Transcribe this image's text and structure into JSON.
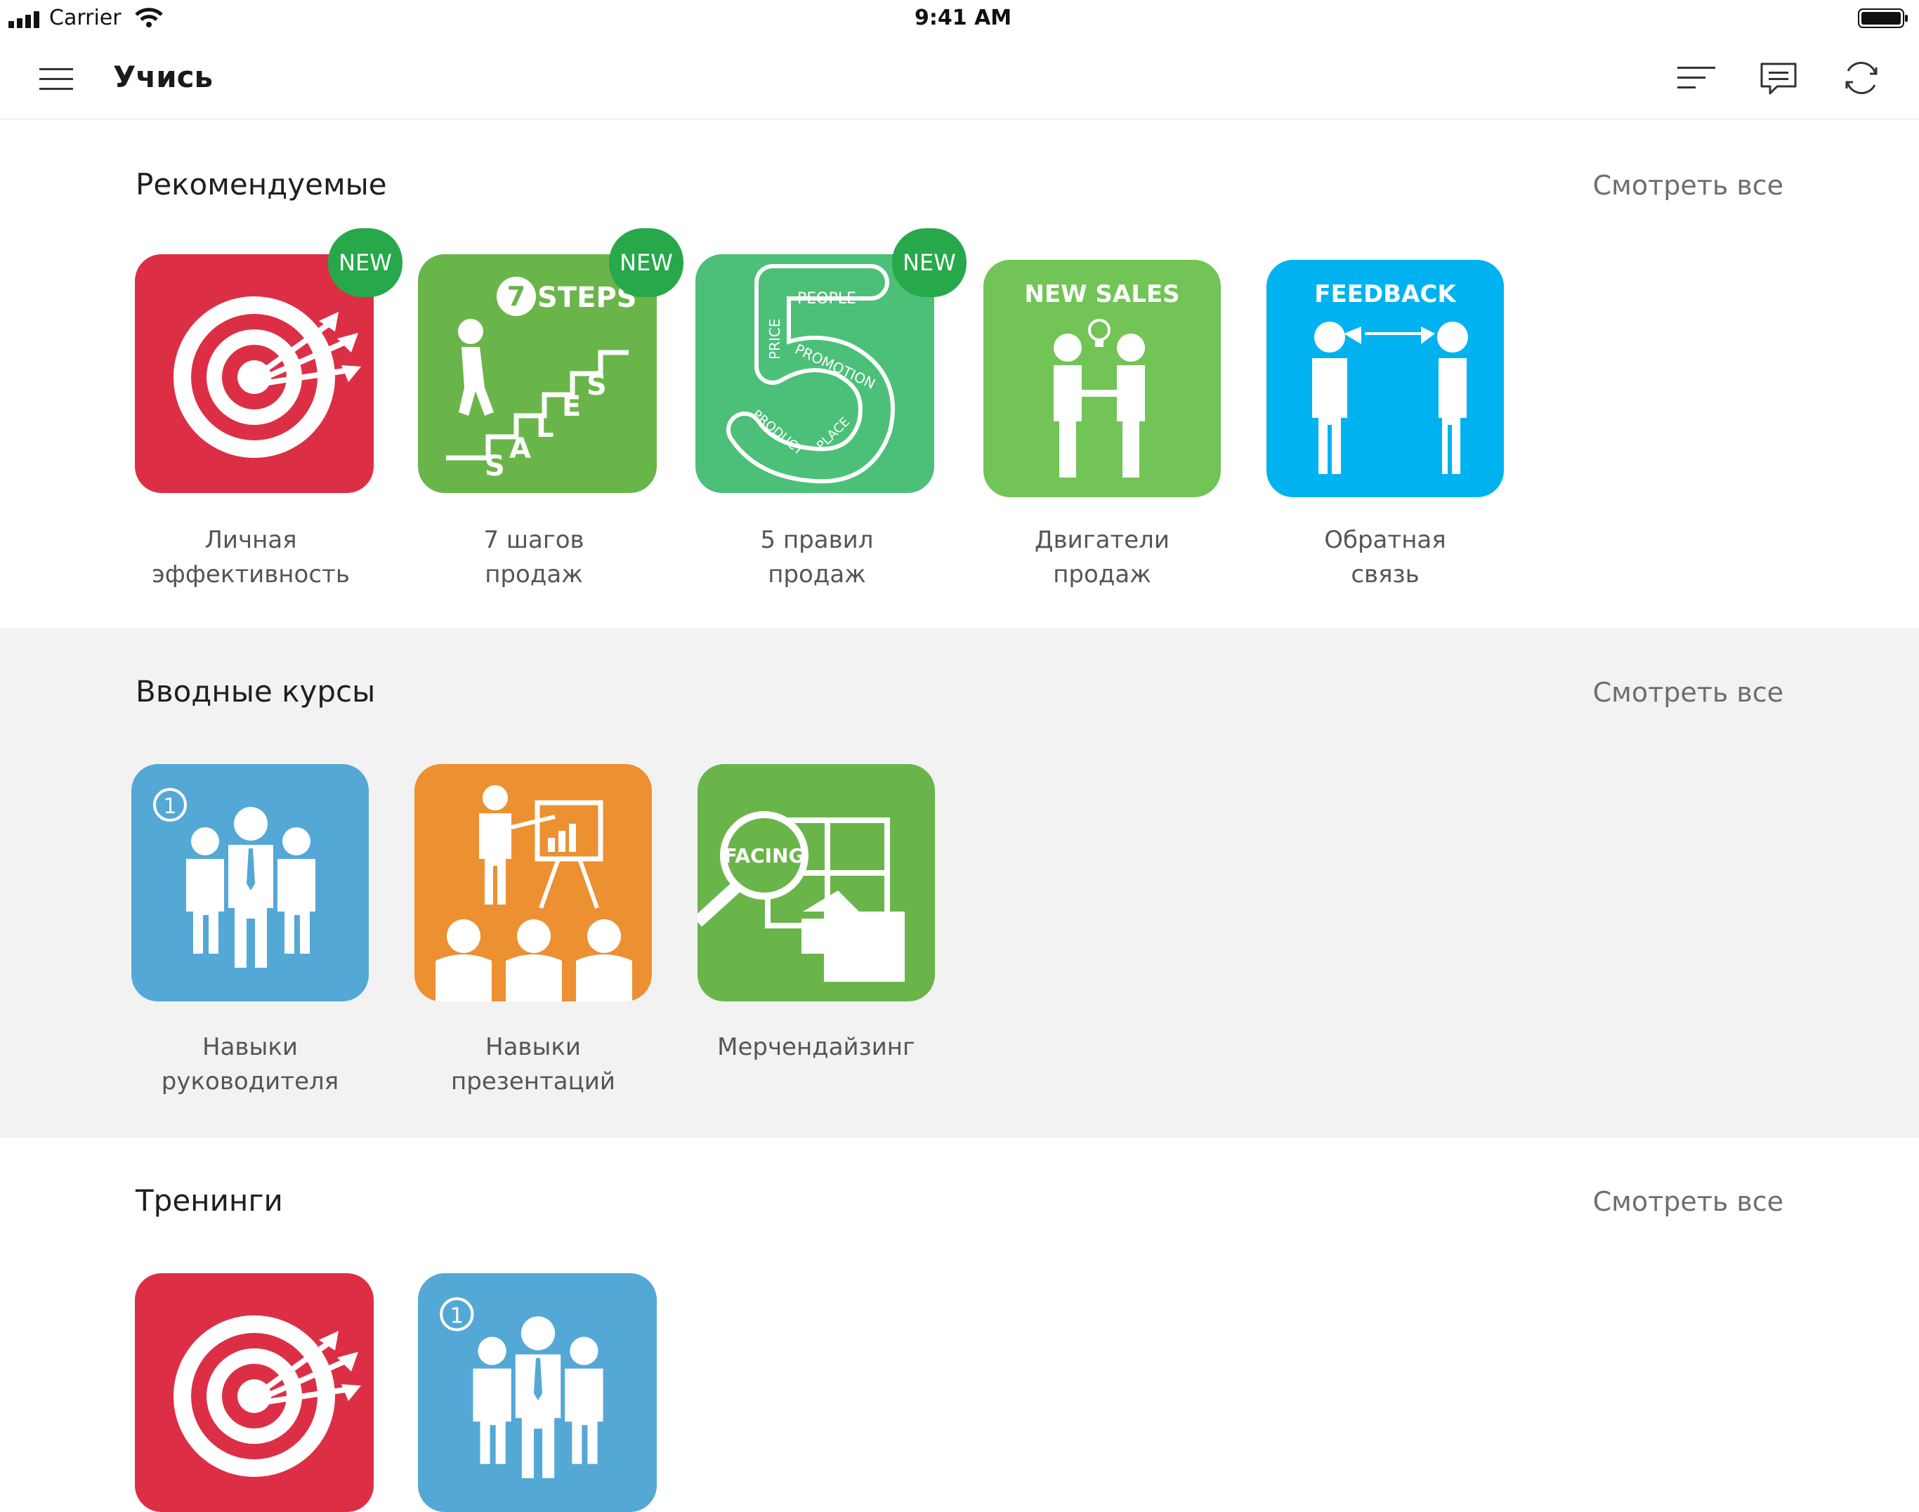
{
  "status_bar": {
    "carrier": "Carrier",
    "time": "9:41 AM"
  },
  "header": {
    "title": "Учись"
  },
  "colors": {
    "red": "#dc2f45",
    "green_dark": "#6ab54a",
    "green_mint": "#4cc078",
    "green_light": "#71c455",
    "blue_bright": "#00b2f0",
    "blue": "#54a8d6",
    "orange": "#ec9032",
    "badge": "#27a84a",
    "section_gray": "#f2f2f2"
  },
  "sections": [
    {
      "title": "Рекомендуемые",
      "see_all": "Смотреть все",
      "items": [
        {
          "icon": "target-icon",
          "line1": "Личная",
          "line2": "эффективность",
          "badge": "NEW"
        },
        {
          "icon": "sales-steps-icon",
          "line1": "7 шагов",
          "line2": "продаж",
          "badge": "NEW",
          "art_text": "STEPS"
        },
        {
          "icon": "five-rules-icon",
          "line1": "5 правил",
          "line2": "продаж",
          "badge": "NEW",
          "art_words": [
            "PEOPLE",
            "PRICE",
            "PROMOTION",
            "PRODUCT",
            "PLACE"
          ]
        },
        {
          "icon": "handshake-icon",
          "line1": "Двигатели",
          "line2": "продаж",
          "art_text": "NEW SALES"
        },
        {
          "icon": "feedback-icon",
          "line1": "Обратная",
          "line2": "связь",
          "art_text": "FEEDBACK"
        }
      ]
    },
    {
      "title": "Вводные курсы",
      "see_all": "Смотреть все",
      "items": [
        {
          "icon": "team-icon",
          "line1": "Навыки",
          "line2": "руководителя"
        },
        {
          "icon": "presentation-icon",
          "line1": "Навыки",
          "line2": "презентаций"
        },
        {
          "icon": "merchandising-icon",
          "line1": "Мерчендайзинг",
          "line2": "",
          "art_text": "FACING"
        }
      ]
    },
    {
      "title": "Тренинги",
      "see_all": "Смотреть все",
      "items": [
        {
          "icon": "target-icon"
        },
        {
          "icon": "team-icon"
        }
      ]
    }
  ]
}
